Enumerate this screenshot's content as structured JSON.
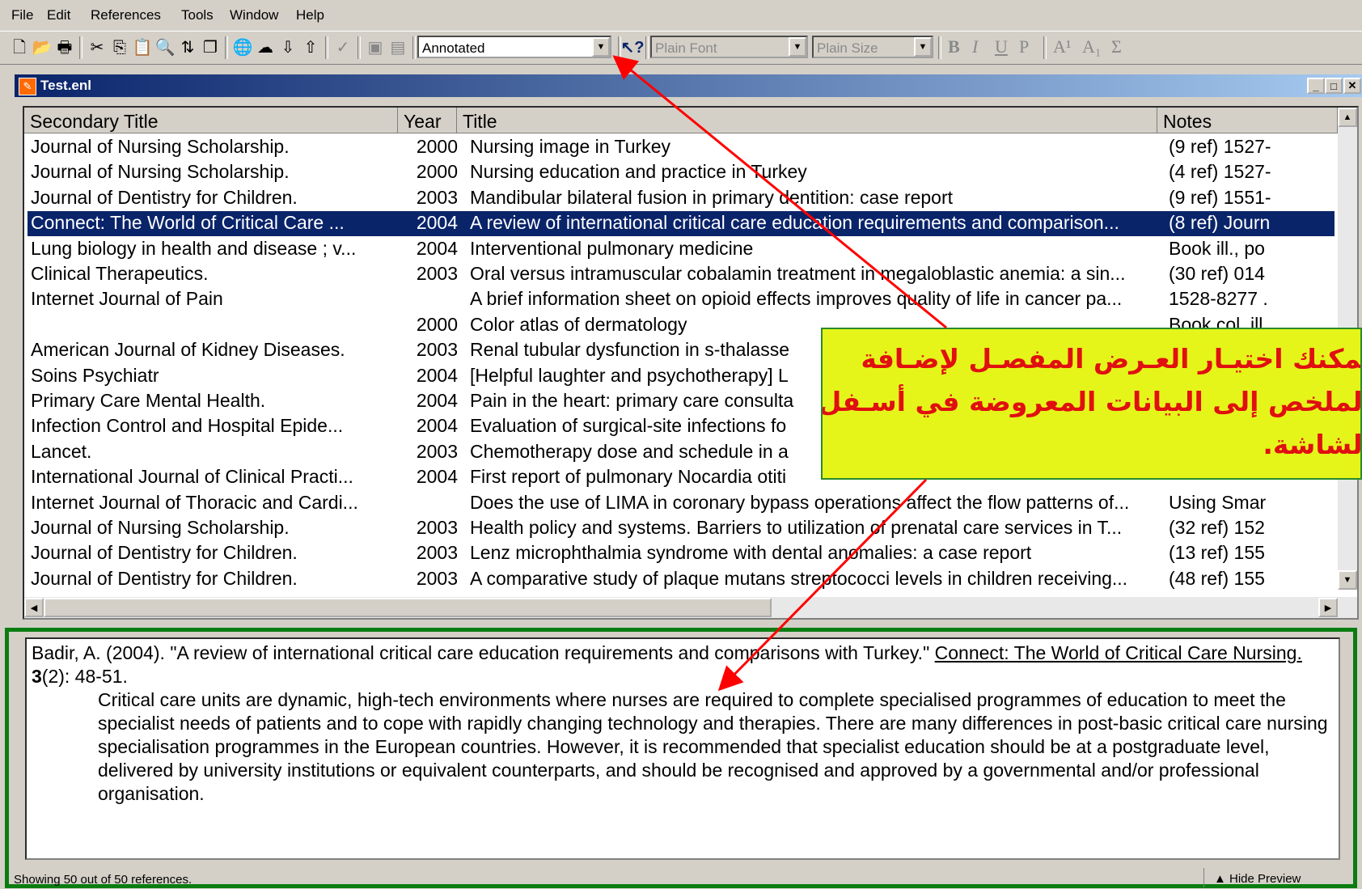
{
  "menu": [
    "File",
    "Edit",
    "References",
    "Tools",
    "Window",
    "Help"
  ],
  "toolbar": {
    "style_value": "Annotated",
    "font_value": "Plain Font",
    "size_value": "Plain Size",
    "format_buttons": [
      "B",
      "I",
      "U",
      "P",
      "A¹",
      "A₁",
      "Σ"
    ]
  },
  "window": {
    "title": "Test.enl"
  },
  "columns": [
    "Secondary Title",
    "Year",
    "Title",
    "Notes"
  ],
  "rows": [
    {
      "secondary": "Journal of Nursing Scholarship.",
      "year": "2000",
      "title": "Nursing image in Turkey",
      "notes": "(9 ref) 1527-"
    },
    {
      "secondary": "Journal of Nursing Scholarship.",
      "year": "2000",
      "title": "Nursing education and practice in Turkey",
      "notes": "(4 ref) 1527-"
    },
    {
      "secondary": "Journal of Dentistry for Children.",
      "year": "2003",
      "title": "Mandibular bilateral fusion in primary dentition: case report",
      "notes": "(9 ref) 1551-"
    },
    {
      "secondary": "Connect: The World of Critical Care ...",
      "year": "2004",
      "title": "A review of international critical care education requirements and comparison...",
      "notes": "(8 ref) Journ",
      "selected": true
    },
    {
      "secondary": "Lung biology in health and disease ; v...",
      "year": "2004",
      "title": "Interventional pulmonary medicine",
      "notes": "Book ill., po"
    },
    {
      "secondary": "Clinical Therapeutics.",
      "year": "2003",
      "title": "Oral versus intramuscular cobalamin treatment in megaloblastic anemia: a sin...",
      "notes": "(30 ref) 014"
    },
    {
      "secondary": "Internet Journal of Pain",
      "year": "",
      "title": "A brief information sheet on opioid effects improves quality of life in cancer pa...",
      "notes": "1528-8277 ."
    },
    {
      "secondary": "",
      "year": "2000",
      "title": "Color atlas of dermatology",
      "notes": "Book col. ill."
    },
    {
      "secondary": "American Journal of Kidney Diseases.",
      "year": "2003",
      "title": "Renal tubular dysfunction in s-thalasse",
      "notes": ""
    },
    {
      "secondary": "Soins Psychiatr",
      "year": "2004",
      "title": "[Helpful laughter and psychotherapy] L",
      "notes": ""
    },
    {
      "secondary": "Primary Care Mental Health.",
      "year": "2004",
      "title": "Pain in the heart: primary care consulta",
      "notes": ""
    },
    {
      "secondary": "Infection Control and Hospital Epide...",
      "year": "2004",
      "title": "Evaluation of surgical-site infections fo",
      "notes": ""
    },
    {
      "secondary": "Lancet.",
      "year": "2003",
      "title": "Chemotherapy dose and schedule in a",
      "notes": ""
    },
    {
      "secondary": "International Journal of Clinical Practi...",
      "year": "2004",
      "title": "First report of pulmonary Nocardia otiti",
      "notes": ""
    },
    {
      "secondary": "Internet Journal of Thoracic and Cardi...",
      "year": "",
      "title": "Does the use of LIMA in coronary bypass operations affect the flow patterns of...",
      "notes": "Using Smar"
    },
    {
      "secondary": "Journal of Nursing Scholarship.",
      "year": "2003",
      "title": "Health policy and systems. Barriers to utilization of prenatal care services in T...",
      "notes": "(32 ref) 152"
    },
    {
      "secondary": "Journal of Dentistry for Children.",
      "year": "2003",
      "title": "Lenz microphthalmia syndrome with dental anomalies: a case report",
      "notes": "(13 ref) 155"
    },
    {
      "secondary": "Journal of Dentistry for Children.",
      "year": "2003",
      "title": "A comparative study of plaque mutans streptococci levels in children receiving...",
      "notes": "(48 ref) 155"
    }
  ],
  "preview": {
    "authors": "Badir, A. (2004). ",
    "article": "\"A review of international critical care education requirements and comparisons with Turkey.\" ",
    "journal": "Connect: The World of Critical Care Nursing.",
    "volume": "3",
    "issue_pages": "(2): 48-51.",
    "abstract": "Critical care units are dynamic, high-tech environments where nurses are required to complete specialised programmes of education to meet the specialist needs of patients and to cope with rapidly changing technology and therapies. There are many differences in post-basic critical care nursing specialisation programmes in the European countries. However, it is recommended that specialist education should be at a postgraduate level, delivered by university institutions or equivalent counterparts, and should be recognised and approved by a governmental and/or professional organisation."
  },
  "status": {
    "text": "Showing 50 out of 50 references.",
    "hide_preview": "Hide Preview"
  },
  "annotation": {
    "line1": "يمكنك اختيـار العـرض المفصـل لإضـافة",
    "line2": "الملخص إلى البيانات المعروضة في أسـفل",
    "line3": "الشاشة."
  },
  "colors": {
    "selection": "#0a246a",
    "arrow": "#ff0000",
    "note_bg": "#e5f51a",
    "note_text": "#e01010",
    "preview_border": "#0a7d10"
  }
}
